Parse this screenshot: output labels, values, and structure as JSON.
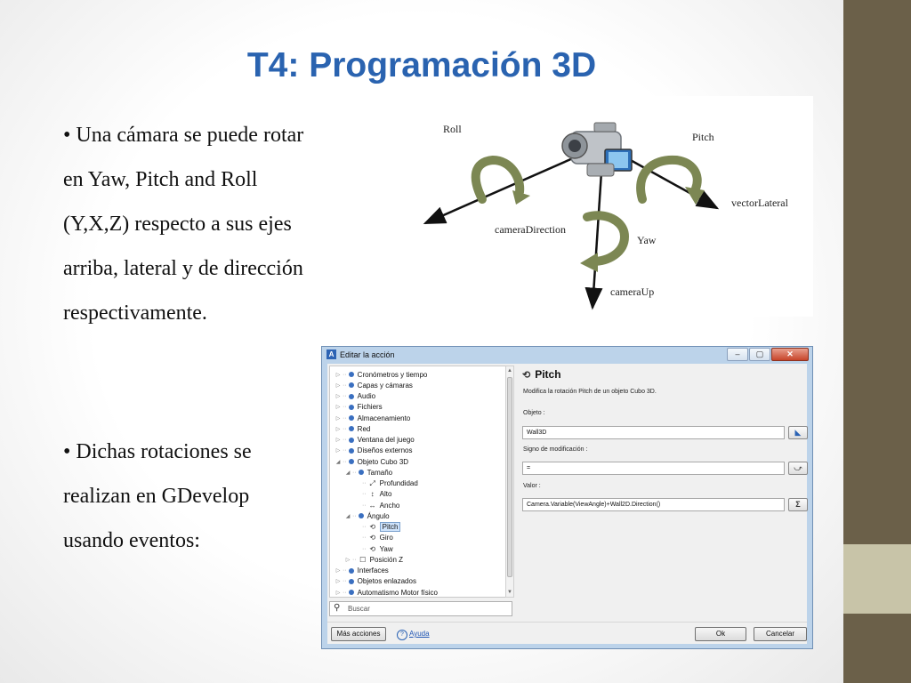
{
  "title": "T4: Programación 3D",
  "bullets": [
    [
      "• Una cámara se puede rotar",
      "en Yaw, Pitch and Roll",
      "(Y,X,Z) respecto a sus ejes",
      "arriba, lateral y de dirección",
      "respectivamente."
    ],
    [
      "• Dichas rotaciones se",
      "realizan en GDevelop",
      "usando eventos:"
    ]
  ],
  "diagram": {
    "labels": {
      "roll": "Roll",
      "pitch": "Pitch",
      "yaw": "Yaw",
      "vector_lateral": "vectorLateral",
      "camera_direction": "cameraDirection",
      "camera_up": "cameraUp"
    },
    "arrow_color": "#7c8753",
    "camera_icon": "camcorder-icon"
  },
  "dialog": {
    "title": "Editar la acción",
    "window_buttons": [
      "minimize",
      "maximize",
      "close"
    ],
    "tree": [
      {
        "label": "Cronómetros y tiempo",
        "icon": "dot"
      },
      {
        "label": "Capas y cámaras",
        "icon": "dot"
      },
      {
        "label": "Audio",
        "icon": "dot"
      },
      {
        "label": "Fichiers",
        "icon": "dot"
      },
      {
        "label": "Almacenamiento",
        "icon": "dot"
      },
      {
        "label": "Red",
        "icon": "dot"
      },
      {
        "label": "Ventana del juego",
        "icon": "dot"
      },
      {
        "label": "Diseños externos",
        "icon": "dot"
      },
      {
        "label": "Objeto Cubo 3D",
        "icon": "dot"
      },
      {
        "label": "Tamaño",
        "icon": "dot"
      },
      {
        "label": "Profundidad",
        "icon": "diagonal-resize-icon"
      },
      {
        "label": "Alto",
        "icon": "vertical-resize-icon"
      },
      {
        "label": "Ancho",
        "icon": "horizontal-resize-icon"
      },
      {
        "label": "Ángulo",
        "icon": "dot"
      },
      {
        "label": "Pitch",
        "icon": "rotate-icon",
        "selected": true
      },
      {
        "label": "Giro",
        "icon": "rotate-icon"
      },
      {
        "label": "Yaw",
        "icon": "rotate-icon"
      },
      {
        "label": "Posición Z",
        "icon": "box-icon"
      },
      {
        "label": "Interfaces",
        "icon": "dot"
      },
      {
        "label": "Objetos enlazados",
        "icon": "dot"
      },
      {
        "label": "Automatismo Motor físico",
        "icon": "dot"
      }
    ],
    "search_placeholder": "Buscar",
    "panel": {
      "title": "Pitch",
      "description": "Modifica la rotación Pitch de un objeto Cubo 3D.",
      "fields": [
        {
          "label": "Objeto :",
          "value": "Wall3D",
          "button_icon": "object-picker-icon"
        },
        {
          "label": "Signo de modificación :",
          "value": "=",
          "button_icon": "operator-picker-icon"
        },
        {
          "label": "Valor :",
          "value": "Camera.Variable(ViewAngle)+Wall2D.Direction()",
          "button_icon": "expression-editor-icon"
        }
      ]
    },
    "buttons": {
      "more": "Más acciones",
      "help": "Ayuda",
      "ok": "Ok",
      "cancel": "Cancelar"
    }
  }
}
